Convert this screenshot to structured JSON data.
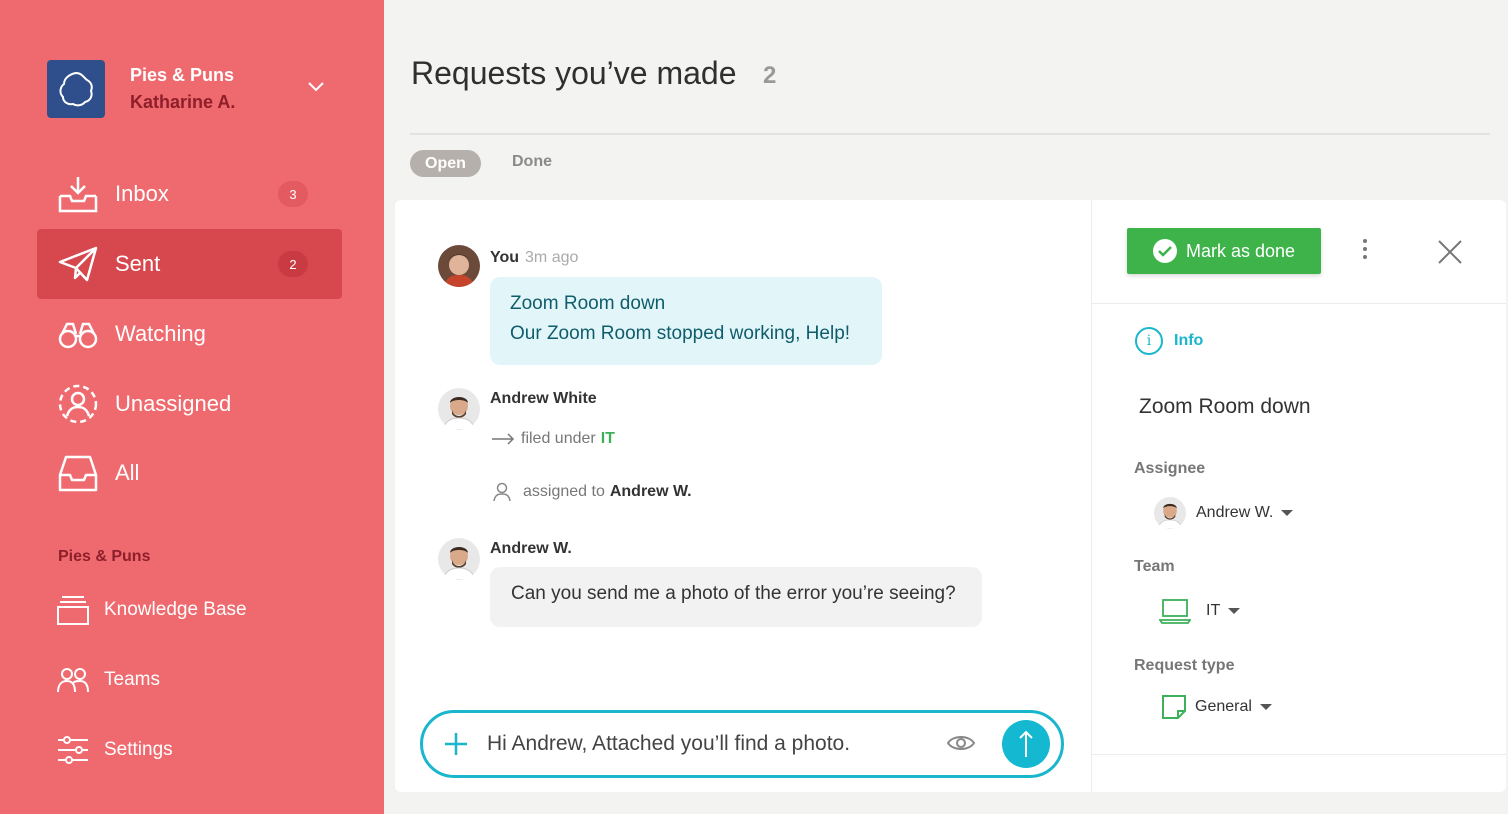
{
  "workspace": {
    "name": "Pies & Puns",
    "user": "Katharine A."
  },
  "nav": [
    {
      "label": "Inbox",
      "badge": "3"
    },
    {
      "label": "Sent",
      "badge": "2"
    },
    {
      "label": "Watching"
    },
    {
      "label": "Unassigned"
    },
    {
      "label": "All"
    }
  ],
  "section": {
    "title": "Pies & Puns",
    "items": [
      "Knowledge Base",
      "Teams",
      "Settings"
    ]
  },
  "header": {
    "title": "Requests you’ve made",
    "count": "2"
  },
  "tabs": {
    "open": "Open",
    "done": "Done"
  },
  "conversation": {
    "msg1": {
      "author": "You",
      "time": "3m ago",
      "title": "Zoom Room down",
      "body": "Our Zoom Room stopped working, Help!"
    },
    "event": {
      "author": "Andrew White",
      "filed_prefix": "filed under",
      "filed_team": "IT",
      "assigned_prefix": "assigned to",
      "assigned_to": "Andrew W."
    },
    "msg2": {
      "author": "Andrew W.",
      "body": "Can you send me a photo of the error you’re seeing?"
    },
    "composer_value": "Hi Andrew, Attached you’ll find a photo."
  },
  "details": {
    "mark_done": "Mark as done",
    "info_label": "Info",
    "title": "Zoom Room down",
    "assignee_label": "Assignee",
    "assignee": "Andrew W.",
    "team_label": "Team",
    "team": "IT",
    "request_type_label": "Request type",
    "request_type": "General"
  },
  "colors": {
    "sidebar": "#ef6a6f",
    "active": "#d6474e",
    "accent": "#19b6cc",
    "success": "#3db34a"
  }
}
